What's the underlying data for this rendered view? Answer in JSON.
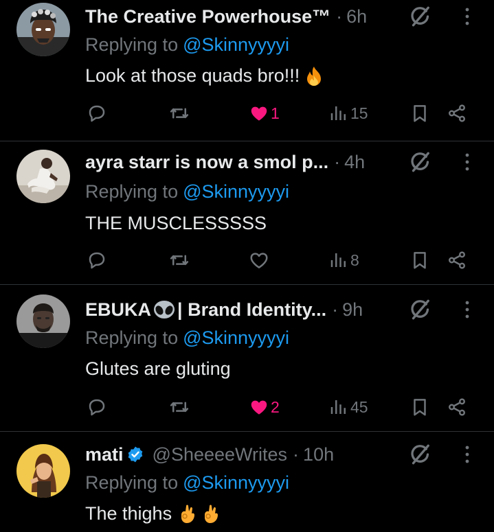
{
  "replies": [
    {
      "display_name": "The Creative Powerhouse™",
      "handle": "",
      "time": "6h",
      "replying_label": "Replying to",
      "replying_to": "@Skinnyyyyi",
      "text": "Look at those quads bro!!!",
      "emojis": [
        "fire-emoji"
      ],
      "verified": false,
      "liked": true,
      "likes": "1",
      "views": "15"
    },
    {
      "display_name": "ayra starr is now a smol p...",
      "handle": "",
      "time": "4h",
      "replying_label": "Replying to",
      "replying_to": "@Skinnyyyyi",
      "text": "THE MUSCLESSSSS",
      "emojis": [],
      "verified": false,
      "liked": false,
      "likes": "",
      "views": "8"
    },
    {
      "display_name": "EBUKA",
      "display_name_suffix": "| Brand Identity...",
      "handle": "",
      "time": "9h",
      "replying_label": "Replying to",
      "replying_to": "@Skinnyyyyi",
      "text": "Glutes are gluting",
      "emojis": [],
      "verified": false,
      "liked": true,
      "likes": "2",
      "views": "45"
    },
    {
      "display_name": "mati",
      "handle": "@SheeeeWrites",
      "time": "10h",
      "replying_label": "Replying to",
      "replying_to": "@Skinnyyyyi",
      "text": "The thighs",
      "emojis": [
        "ok-hand-emoji",
        "ok-hand-emoji"
      ],
      "verified": true,
      "liked": false,
      "likes": "",
      "views": ""
    }
  ],
  "separator": "·",
  "icons": [
    "reply-icon",
    "retweet-icon",
    "like-icon",
    "views-icon",
    "bookmark-icon",
    "share-icon",
    "grok-icon",
    "more-icon"
  ],
  "colors": {
    "background": "#000000",
    "text_primary": "#e7e9ea",
    "text_secondary": "#71767b",
    "link": "#1d9bf0",
    "like": "#f91880",
    "divider": "#2f3336",
    "verified": "#1d9bf0"
  }
}
